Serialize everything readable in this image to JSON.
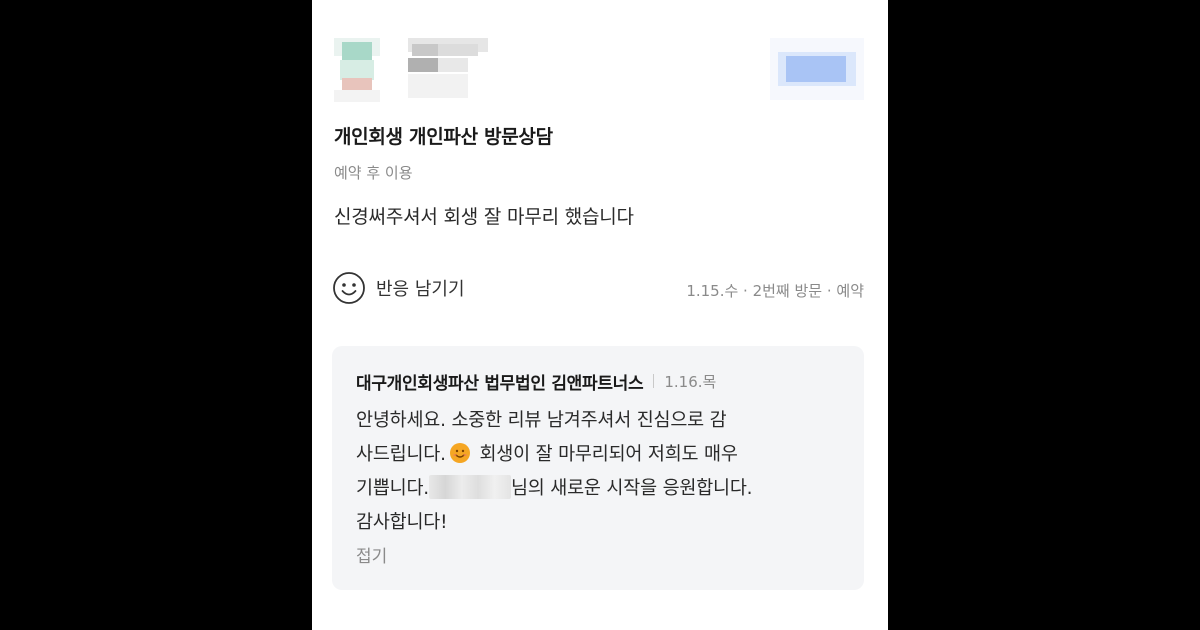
{
  "review": {
    "title": "개인회생 개인파산 방문상담",
    "visit_type": "예약 후 이용",
    "body": "신경써주셔서 회생 잘 마무리 했습니다",
    "react_label": "반응 남기기",
    "meta": "1.15.수 · 2번째 방문 · 예약"
  },
  "reply": {
    "author": "대구개인회생파산 법무법인 김앤파트너스",
    "date": "1.16.목",
    "line1": "안녕하세요. 소중한 리뷰 남겨주셔서 진심으로 감",
    "line2a": "사드립니다.",
    "line2b": " 회생이 잘 마무리되어 저희도 매우",
    "line3a": "기쁩니다.",
    "line3b": "님의 새로운 시작을 응원합니다.",
    "line4": "감사합니다!",
    "fold_label": "접기"
  },
  "icons": {
    "react": "smile-icon",
    "emoji": "smiling-face-emoji-icon"
  },
  "colors": {
    "background": "#000000",
    "card": "#ffffff",
    "reply_bg": "#f4f5f7",
    "muted_text": "#8a8a8a",
    "follow_blur": "#a9c4f5"
  }
}
